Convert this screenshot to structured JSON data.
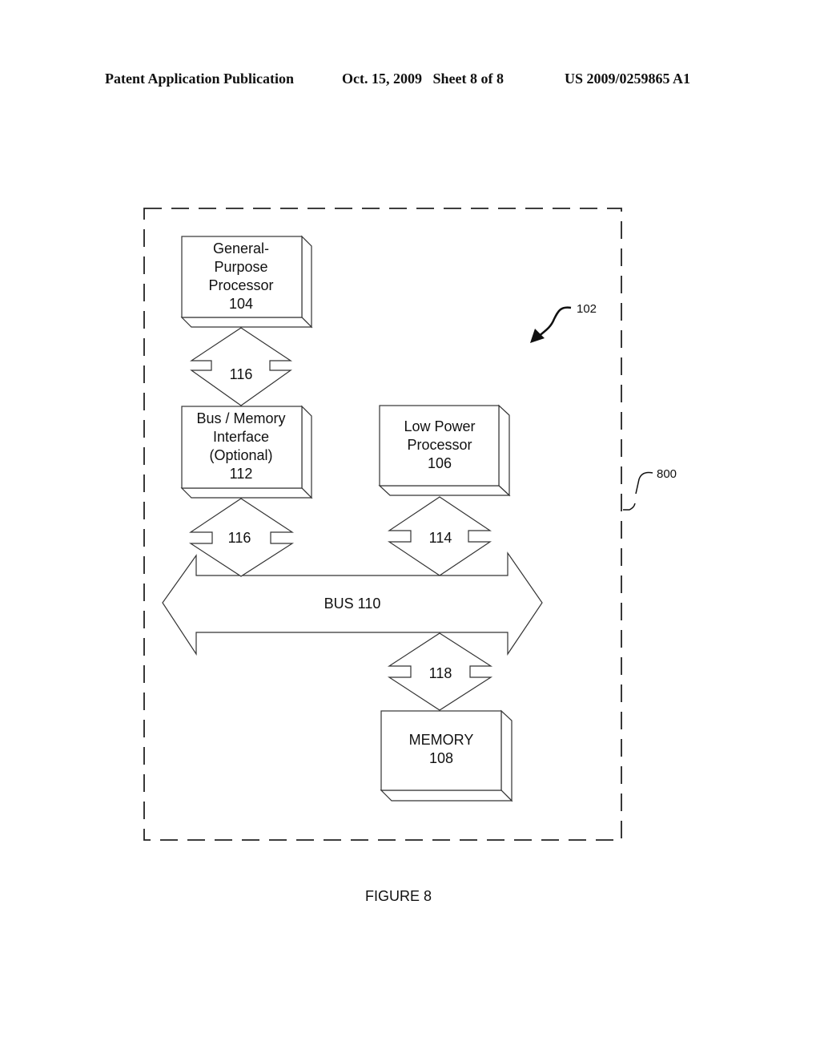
{
  "header": {
    "publication_type": "Patent Application Publication",
    "date_sheet": "Oct. 15, 2009   Sheet 8 of 8",
    "patent_number": "US 2009/0259865 A1"
  },
  "diagram": {
    "boundary_ref": "800",
    "device_ref": "102",
    "blocks": {
      "general_processor": [
        "General-",
        "Purpose",
        "Processor",
        "104"
      ],
      "bus_memory_interface": [
        "Bus / Memory",
        "Interface",
        "(Optional)",
        "112"
      ],
      "low_power_processor": [
        "Low Power",
        "Processor",
        "106"
      ],
      "memory": [
        "MEMORY",
        "108"
      ]
    },
    "connectors": {
      "gp_to_interface": "116",
      "interface_to_bus": "116",
      "lowpower_to_bus": "114",
      "bus_to_memory": "118"
    },
    "bus_label": "BUS 110"
  },
  "figure_caption": "FIGURE 8"
}
